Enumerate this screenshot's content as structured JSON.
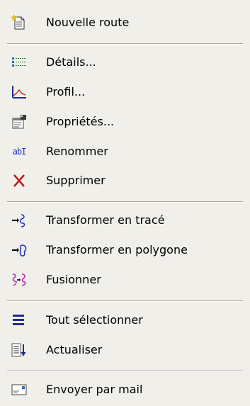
{
  "menu": {
    "items": [
      {
        "label": "Nouvelle route",
        "icon": "new-document-icon"
      },
      {
        "label": "Détails...",
        "icon": "details-list-icon"
      },
      {
        "label": "Profil...",
        "icon": "profile-chart-icon"
      },
      {
        "label": "Propriétés...",
        "icon": "properties-icon"
      },
      {
        "label": "Renommer",
        "icon": "rename-icon",
        "icon_text": "abI"
      },
      {
        "label": "Supprimer",
        "icon": "delete-x-icon"
      },
      {
        "label": "Transformer en tracé",
        "icon": "convert-to-track-icon"
      },
      {
        "label": "Transformer en polygone",
        "icon": "convert-to-polygon-icon"
      },
      {
        "label": "Fusionner",
        "icon": "merge-icon"
      },
      {
        "label": "Tout sélectionner",
        "icon": "select-all-icon"
      },
      {
        "label": "Actualiser",
        "icon": "refresh-icon"
      },
      {
        "label": "Envoyer par mail",
        "icon": "mail-icon"
      }
    ]
  },
  "colors": {
    "menu_background": "#f0efe9",
    "separator_dark": "#a9a79d",
    "separator_light": "#ffffff",
    "icon_navy": "#1f2e8c",
    "icon_red": "#c01818",
    "icon_magenta": "#c020c0",
    "icon_blue": "#2030c0"
  }
}
